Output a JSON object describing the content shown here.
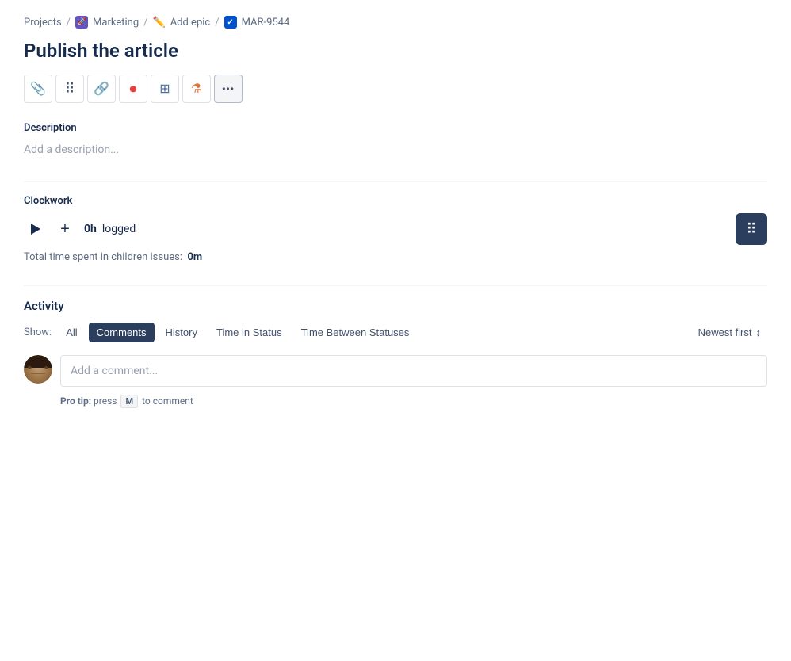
{
  "breadcrumb": {
    "projects_label": "Projects",
    "sep1": "/",
    "marketing_label": "Marketing",
    "sep2": "/",
    "epic_label": "Add epic",
    "sep3": "/",
    "issue_id": "MAR-9544"
  },
  "page": {
    "title": "Publish the article"
  },
  "toolbar": {
    "icons": [
      {
        "name": "attachment-icon",
        "symbol": "📎",
        "label": "Attach"
      },
      {
        "name": "hierarchy-structure-icon",
        "symbol": "⠿",
        "label": "Structure"
      },
      {
        "name": "link-icon",
        "symbol": "🔗",
        "label": "Link"
      },
      {
        "name": "record-icon",
        "symbol": "⏺",
        "label": "Record"
      },
      {
        "name": "table-icon",
        "symbol": "⊞",
        "label": "Table"
      },
      {
        "name": "flask-icon",
        "symbol": "⚗",
        "label": "Flask"
      },
      {
        "name": "more-icon",
        "symbol": "•••",
        "label": "More"
      }
    ]
  },
  "description": {
    "label": "Description",
    "placeholder": "Add a description..."
  },
  "clockwork": {
    "label": "Clockwork",
    "logged_hours": "0h",
    "logged_suffix": "logged",
    "total_time_label": "Total time spent in children issues:",
    "total_time_value": "0m"
  },
  "activity": {
    "label": "Activity",
    "show_label": "Show:",
    "tabs": [
      {
        "id": "all",
        "label": "All",
        "active": false
      },
      {
        "id": "comments",
        "label": "Comments",
        "active": true
      },
      {
        "id": "history",
        "label": "History",
        "active": false
      },
      {
        "id": "time-in-status",
        "label": "Time in Status",
        "active": false
      },
      {
        "id": "time-between-statuses",
        "label": "Time Between Statuses",
        "active": false
      }
    ],
    "sort_label": "Newest first",
    "comment_placeholder": "Add a comment...",
    "pro_tip_text": "Pro tip:",
    "pro_tip_key": "M",
    "pro_tip_suffix": "to comment"
  }
}
